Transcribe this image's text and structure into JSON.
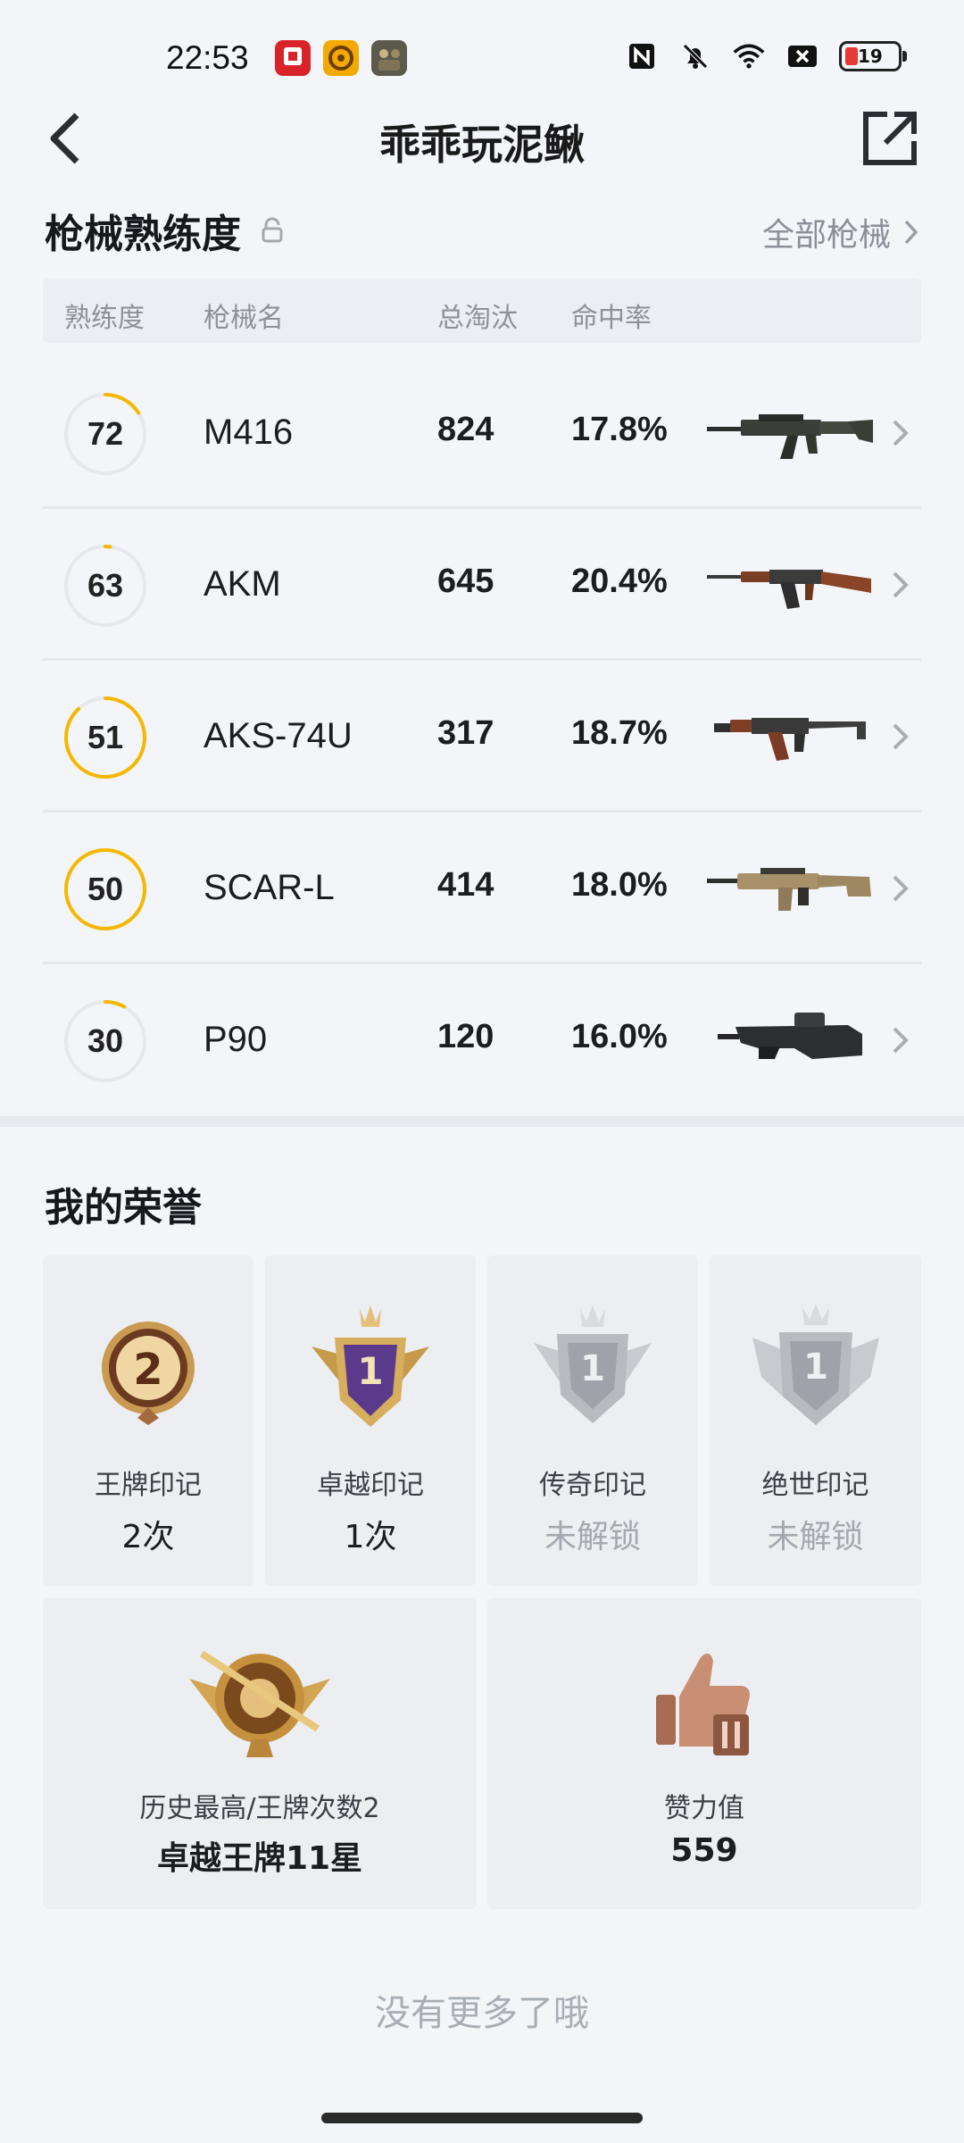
{
  "status_bar": {
    "time": "22:53",
    "battery": "19",
    "icons": [
      "nfc-icon",
      "mute-icon",
      "wifi-icon",
      "sim-x-icon",
      "battery-icon"
    ]
  },
  "header": {
    "title": "乖乖玩泥鳅"
  },
  "weapons_section": {
    "title": "枪械熟练度",
    "all_link": "全部枪械",
    "columns": {
      "proficiency": "熟练度",
      "name": "枪械名",
      "kills": "总淘汰",
      "hit_rate": "命中率"
    },
    "rows": [
      {
        "level": "72",
        "progress": 0.16,
        "name": "M416",
        "kills": "824",
        "rate": "17.8%"
      },
      {
        "level": "63",
        "progress": 0.02,
        "name": "AKM",
        "kills": "645",
        "rate": "20.4%"
      },
      {
        "level": "51",
        "progress": 0.88,
        "name": "AKS-74U",
        "kills": "317",
        "rate": "18.7%"
      },
      {
        "level": "50",
        "progress": 1.0,
        "name": "SCAR-L",
        "kills": "414",
        "rate": "18.0%"
      },
      {
        "level": "30",
        "progress": 0.08,
        "name": "P90",
        "kills": "120",
        "rate": "16.0%"
      }
    ]
  },
  "honors_section": {
    "title": "我的荣誉",
    "cards": [
      {
        "label": "王牌印记",
        "value": "2次",
        "locked": false,
        "badge": "2"
      },
      {
        "label": "卓越印记",
        "value": "1次",
        "locked": false,
        "badge": "1"
      },
      {
        "label": "传奇印记",
        "value": "未解锁",
        "locked": true,
        "badge": "1"
      },
      {
        "label": "绝世印记",
        "value": "未解锁",
        "locked": true,
        "badge": "1"
      }
    ],
    "wide_cards": [
      {
        "label": "历史最高/王牌次数2",
        "value": "卓越王牌11星"
      },
      {
        "label": "赞力值",
        "value": "559"
      }
    ]
  },
  "footer": {
    "no_more": "没有更多了哦"
  },
  "colors": {
    "ring_progress": "#f5b800",
    "ring_track": "#e6e8ec",
    "background": "#f3f5f9"
  }
}
